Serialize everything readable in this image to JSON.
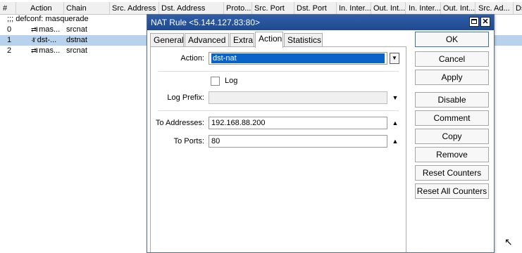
{
  "table": {
    "columns": [
      "#",
      "Action",
      "Chain",
      "Src. Address",
      "Dst. Address",
      "Proto...",
      "Src. Port",
      "Dst. Port",
      "In. Inter...",
      "Out. Int...",
      "In. Inter...",
      "Out. Int...",
      "Src. Ad...",
      "Ds"
    ],
    "comment": ";;; defconf: masquerade",
    "rows": [
      {
        "num": "0",
        "action": "mas...",
        "chain": "srcnat",
        "icon": "masquerade-icon"
      },
      {
        "num": "1",
        "action": "dst-...",
        "chain": "dstnat",
        "icon": "dst-nat-icon"
      },
      {
        "num": "2",
        "action": "mas...",
        "chain": "srcnat",
        "icon": "masquerade-icon"
      }
    ]
  },
  "dialog": {
    "title": "NAT Rule <5.144.127.83:80>",
    "tabs": [
      "General",
      "Advanced",
      "Extra",
      "Action",
      "Statistics"
    ],
    "active_tab": "Action",
    "action_label": "Action:",
    "action_value": "dst-nat",
    "log_label": "Log",
    "log_checked": false,
    "log_prefix_label": "Log Prefix:",
    "log_prefix_value": "",
    "to_addresses_label": "To Addresses:",
    "to_addresses_value": "192.168.88.200",
    "to_ports_label": "To Ports:",
    "to_ports_value": "80",
    "buttons": [
      "OK",
      "Cancel",
      "Apply",
      "Disable",
      "Comment",
      "Copy",
      "Remove",
      "Reset Counters",
      "Reset All Counters"
    ]
  },
  "colors": {
    "titlebar": "#2f5da6",
    "selected_row": "#b8d2ee",
    "selection_highlight": "#0a64c8"
  }
}
